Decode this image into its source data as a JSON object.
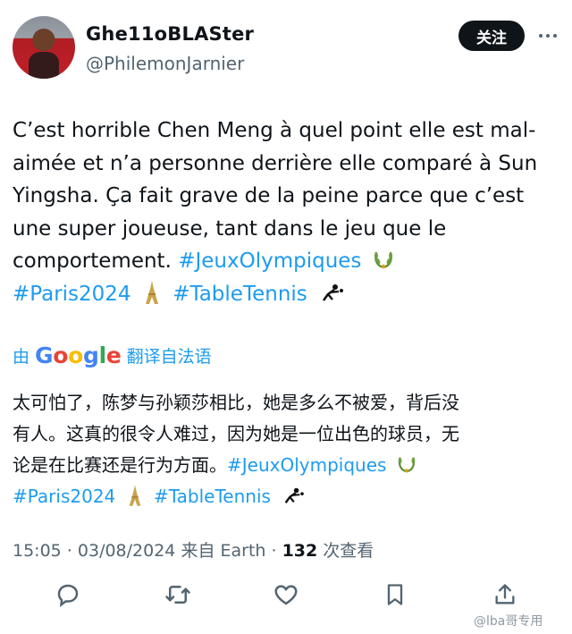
{
  "author": {
    "display_name": "Ghe11oBLASter",
    "handle": "@PhilemonJarnier",
    "avatar_icon": "profile-photo"
  },
  "follow_label": "关注",
  "tweet": {
    "lines": [
      "C’est horrible Chen Meng à quel point elle est mal-",
      "aimée et n’a personne derrière elle comparé à Sun",
      "Yingsha. Ça fait grave de la peine parce que c’est",
      "une super joueuse, tant dans le jeu que le"
    ],
    "line5_text": "comportement. ",
    "hashtag_olympics": "#JeuxOlympiques",
    "hashtag_paris": "#Paris2024",
    "hashtag_tt": "#TableTennis"
  },
  "translate": {
    "prefix": "由",
    "google_G": "G",
    "google_o1": "o",
    "google_o2": "o",
    "google_g": "g",
    "google_l": "l",
    "google_e": "e",
    "suffix": "翻译自法语"
  },
  "translation": {
    "line1": "太可怕了，陈梦与孙颖莎相比，她是多么不被爱，背后没",
    "line2": "有人。这真的很令人难过，因为她是一位出色的球员，无",
    "line3_text": "论是在比赛还是行为方面。",
    "hashtag_olympics": "#JeuxOlympiques",
    "hashtag_paris": "#Paris2024",
    "hashtag_tt": "#TableTennis"
  },
  "meta": {
    "time": "15:05",
    "date": "03/08/2024",
    "source": "来自 Earth",
    "views_count": "132",
    "views_label": " 次查看"
  },
  "actions": [
    "reply-icon",
    "retweet-icon",
    "like-icon",
    "bookmark-icon",
    "share-icon"
  ],
  "watermark": "@lba哥专用",
  "colors": {
    "link": "#1d9bf0",
    "text": "#0f1419",
    "muted": "#536471"
  }
}
